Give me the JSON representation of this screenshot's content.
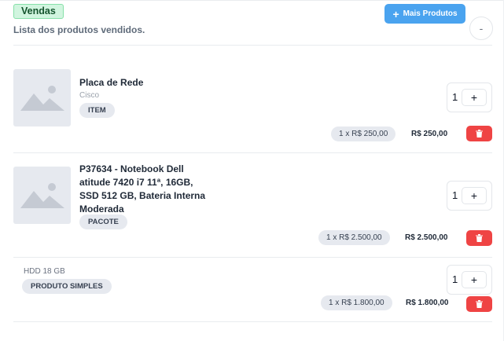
{
  "header": {
    "badge": "Vendas",
    "subtitle": "Lista dos produtos vendidos.",
    "more_button": "Mais Produtos",
    "more_icon": "+",
    "collapse_icon": "-"
  },
  "products": [
    {
      "name": "Placa de Rede",
      "brand": "Cisco",
      "type": "ITEM",
      "quantity": "1",
      "unit_price": "1 x R$ 250,00",
      "total": "R$ 250,00",
      "image_icon": "image-placeholder-icon"
    },
    {
      "name": "P37634 - Notebook Dell atitude 7420 i7 11ª, 16GB, SSD 512 GB, Bateria Interna Moderada",
      "type": "PACOTE",
      "quantity": "1",
      "unit_price": "1 x R$ 2.500,00",
      "total": "R$ 2.500,00",
      "image_icon": "image-placeholder-icon"
    },
    {
      "description": "HDD 18 GB",
      "type": "PRODUTO SIMPLES",
      "quantity": "1",
      "unit_price": "1 x R$ 1.800,00",
      "total": "R$ 1.800,00"
    }
  ],
  "qty_plus": "+",
  "colors": {
    "primary": "#4aa3ef",
    "danger": "#ef4444",
    "badge_bg": "#d1f5df",
    "placeholder_bg": "#e6e9ef"
  }
}
